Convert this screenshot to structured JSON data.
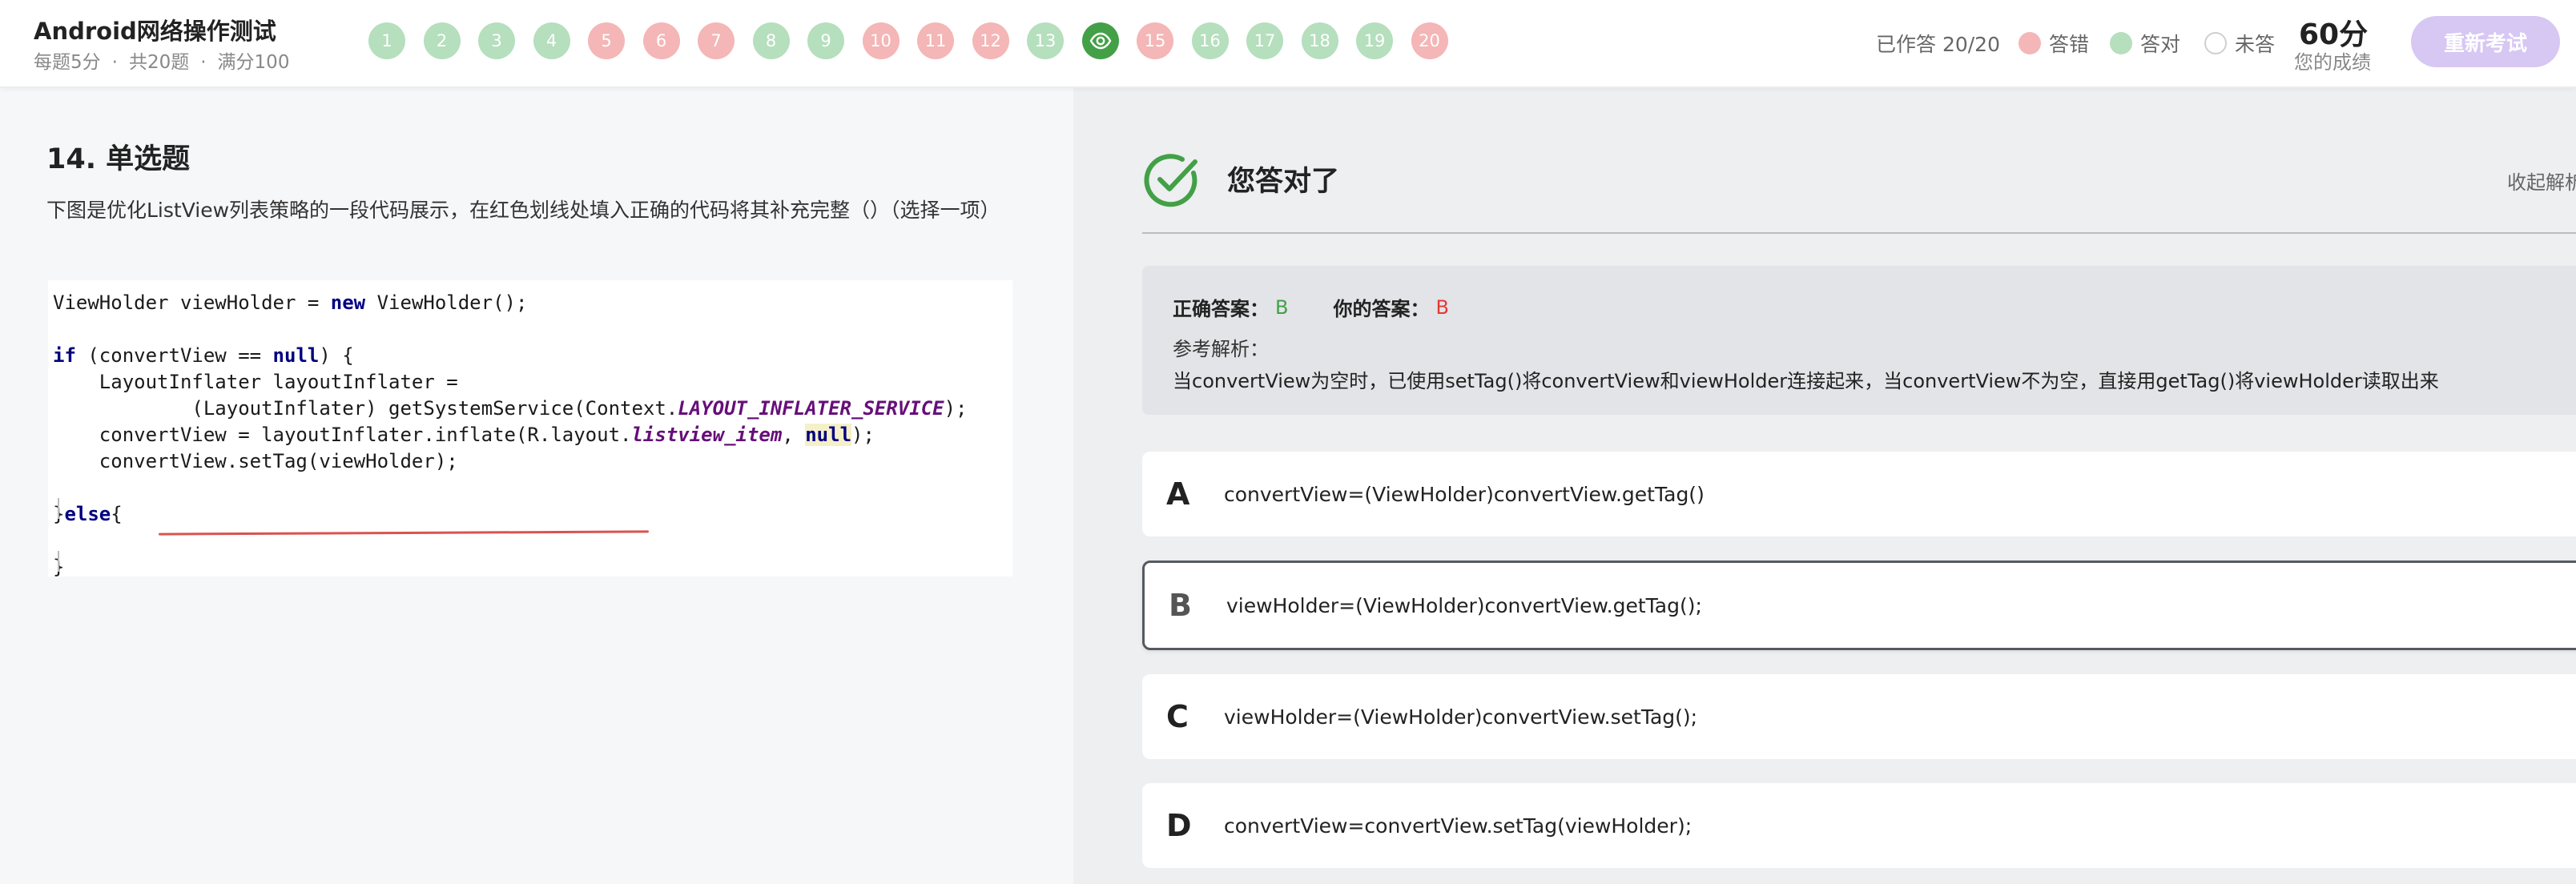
{
  "header": {
    "title": "Android网络操作测试",
    "sub": [
      "每题5分",
      "共20题",
      "满分100"
    ],
    "sub_sep": "·",
    "questions": [
      {
        "label": "1",
        "state": "correct"
      },
      {
        "label": "2",
        "state": "correct"
      },
      {
        "label": "3",
        "state": "correct"
      },
      {
        "label": "4",
        "state": "correct"
      },
      {
        "label": "5",
        "state": "wrong"
      },
      {
        "label": "6",
        "state": "wrong"
      },
      {
        "label": "7",
        "state": "wrong"
      },
      {
        "label": "8",
        "state": "correct"
      },
      {
        "label": "9",
        "state": "correct"
      },
      {
        "label": "10",
        "state": "wrong"
      },
      {
        "label": "11",
        "state": "wrong"
      },
      {
        "label": "12",
        "state": "wrong"
      },
      {
        "label": "13",
        "state": "correct"
      },
      {
        "label": "",
        "state": "current",
        "icon": "eye-icon"
      },
      {
        "label": "15",
        "state": "wrong"
      },
      {
        "label": "16",
        "state": "correct"
      },
      {
        "label": "17",
        "state": "correct"
      },
      {
        "label": "18",
        "state": "correct"
      },
      {
        "label": "19",
        "state": "correct"
      },
      {
        "label": "20",
        "state": "wrong"
      }
    ],
    "answered": "已作答 20/20",
    "legend": [
      {
        "label": "答错",
        "color": "#f4b6b6"
      },
      {
        "label": "答对",
        "color": "#b5dfbd"
      },
      {
        "label": "未答",
        "color": "#ffffff"
      }
    ],
    "score": "60分",
    "score_label": "您的成绩",
    "retake": "重新考试"
  },
  "colors": {
    "correct": "#b5dfbd",
    "wrong": "#f4b6b6",
    "current": "#43a047",
    "accent": "#d6c7f3"
  },
  "question": {
    "title": "14. 单选题",
    "text": "下图是优化ListView列表策略的一段代码展示，在红色划线处填入正确的代码将其补充完整（）（选择一项）"
  },
  "code": {
    "l1_a": "ViewHolder viewHolder = ",
    "l1_kw": "new",
    "l1_b": " ViewHolder();",
    "l3_kw1": "if",
    "l3_a": " (convertView == ",
    "l3_kw2": "null",
    "l3_b": ") {",
    "l4": "    LayoutInflater layoutInflater =",
    "l5_a": "            (LayoutInflater) getSystemService(Context.",
    "l5_const": "LAYOUT_INFLATER_SERVICE",
    "l5_b": ");",
    "l6_a": "    convertView = layoutInflater.inflate(R.layout.",
    "l6_const": "listview_item",
    "l6_mid": ", ",
    "l6_kw": "null",
    "l6_b": ");",
    "l7": "    convertView.setTag(viewHolder);",
    "l9_a": "}",
    "l9_kw": "else",
    "l9_b": "{",
    "l11": "}"
  },
  "result": {
    "verdict": "您答对了",
    "collapse": "收起解析",
    "correct_label": "正确答案：",
    "correct_value": "B",
    "mine_label": "你的答案：",
    "mine_value": "B",
    "ref_label": "参考解析：",
    "ref_text": "当convertView为空时，已使用setTag()将convertView和viewHolder连接起来，当convertView不为空，直接用getTag()将viewHolder读取出来"
  },
  "options": [
    {
      "letter": "A",
      "text": "convertView=(ViewHolder)convertView.getTag()",
      "selected": false
    },
    {
      "letter": "B",
      "text": "viewHolder=(ViewHolder)convertView.getTag();",
      "selected": true
    },
    {
      "letter": "C",
      "text": "viewHolder=(ViewHolder)convertView.setTag();",
      "selected": false
    },
    {
      "letter": "D",
      "text": "convertView=convertView.setTag(viewHolder);",
      "selected": false
    }
  ]
}
